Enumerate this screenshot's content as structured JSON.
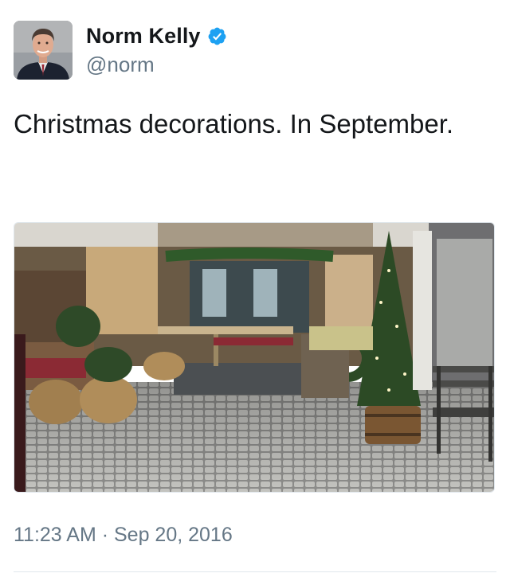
{
  "tweet": {
    "author": {
      "display_name": "Norm Kelly",
      "handle": "@norm",
      "verified": true,
      "avatar_icon": "profile-photo",
      "verified_icon": "verified-badge-icon"
    },
    "text": "Christmas decorations. In September.",
    "media": {
      "type": "photo"
    },
    "timestamp": "11:23 AM · Sep 20, 2016"
  },
  "colors": {
    "text_primary": "#14171a",
    "text_secondary": "#657786",
    "verified_blue": "#1da1f2",
    "divider": "#e1e8ed"
  }
}
